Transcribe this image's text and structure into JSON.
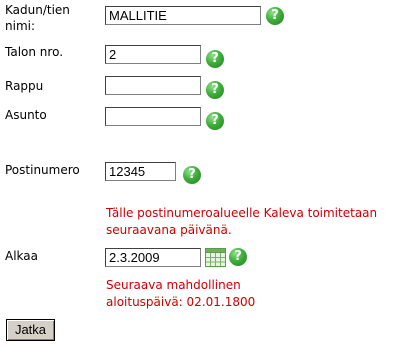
{
  "form": {
    "street": {
      "label": "Kadun/tien nimi:",
      "value": "MALLITIE"
    },
    "house_number": {
      "label": "Talon nro.",
      "value": "2"
    },
    "staircase": {
      "label": "Rappu",
      "value": ""
    },
    "apartment": {
      "label": "Asunto",
      "value": ""
    },
    "postal_code": {
      "label": "Postinumero",
      "value": "12345"
    },
    "postal_note": "Tälle postinumeroalueelle Kaleva toimitetaan seuraavana päivänä.",
    "start": {
      "label": "Alkaa",
      "value": "2.3.2009"
    },
    "start_note_line1": "Seuraava mahdollinen",
    "start_note_line2": "aloituspäivä: 02.01.1800",
    "help_glyph": "?",
    "submit_label": "Jatka"
  }
}
